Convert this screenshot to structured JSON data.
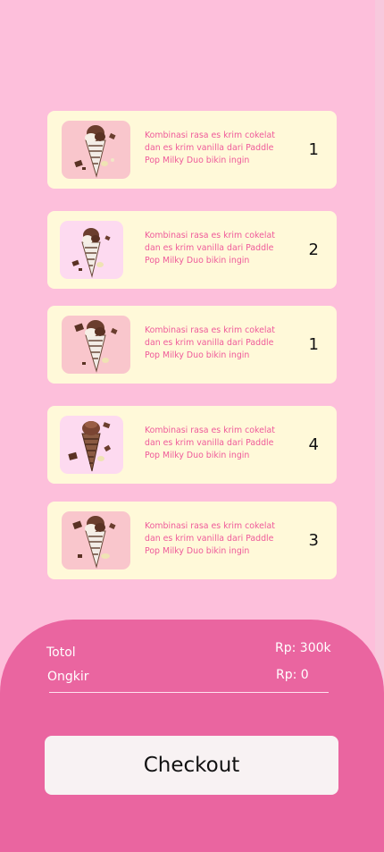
{
  "cart": {
    "items": [
      {
        "description": "Kombinasi rasa es krim cokelat dan es krim vanilla dari Paddle Pop Milky Duo bikin ingin",
        "quantity": "1",
        "thumb_style": "pink",
        "product": "ice-cream-cone"
      },
      {
        "description": "Kombinasi rasa es krim cokelat dan es krim vanilla dari Paddle Pop Milky Duo bikin ingin",
        "quantity": "2",
        "thumb_style": "lilac",
        "product": "ice-cream-cone"
      },
      {
        "description": "Kombinasi rasa es krim cokelat dan es krim vanilla dari Paddle Pop Milky Duo bikin ingin",
        "quantity": "1",
        "thumb_style": "pink",
        "product": "ice-cream-cone"
      },
      {
        "description": "Kombinasi rasa es krim cokelat dan es krim vanilla dari Paddle Pop Milky Duo bikin ingin",
        "quantity": "4",
        "thumb_style": "lilac",
        "product": "chocolate-cone"
      },
      {
        "description": "Kombinasi rasa es krim cokelat dan es krim vanilla dari Paddle Pop Milky Duo bikin ingin",
        "quantity": "3",
        "thumb_style": "pink",
        "product": "ice-cream-cone"
      }
    ]
  },
  "summary": {
    "total_label": "Totol",
    "total_value": "Rp: 300k",
    "shipping_label": "Ongkir",
    "shipping_value": "Rp: 0"
  },
  "checkout": {
    "label": "Checkout"
  },
  "colors": {
    "background": "#fdbfdb",
    "card": "#fff9d9",
    "accent": "#ea65a0",
    "description_text": "#ef5a9a",
    "button": "#f8f2f3"
  }
}
